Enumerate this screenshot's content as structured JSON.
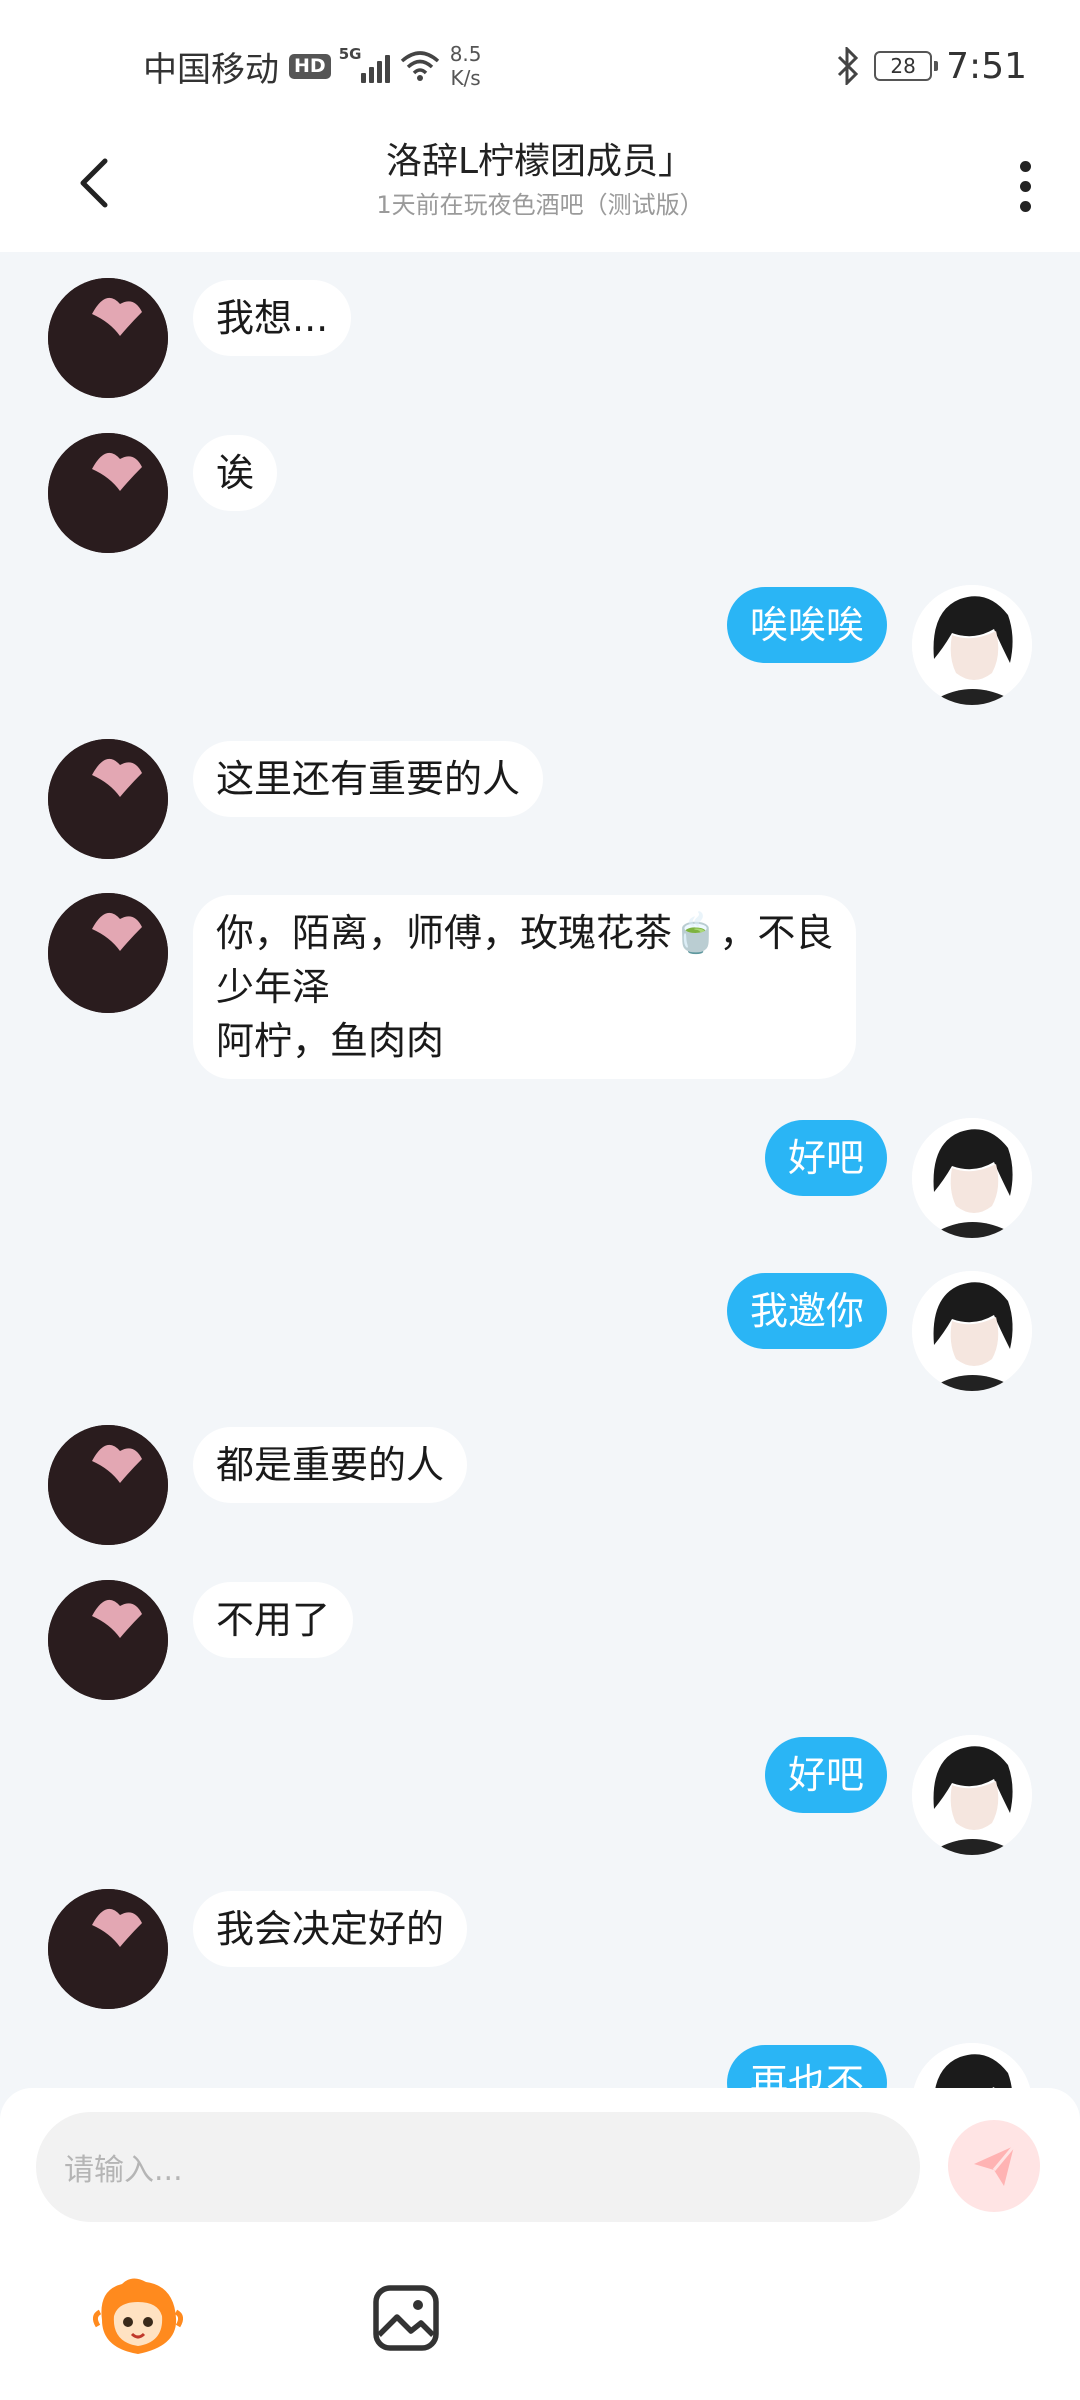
{
  "status_bar": {
    "carrier": "中国移动",
    "hd_badge": "HD",
    "network": "5G",
    "speed_value": "8.5",
    "speed_unit": "K/s",
    "battery": "28",
    "time": "7:51"
  },
  "header": {
    "title": "洛辞L柠檬团成员」",
    "subtitle": "1天前在玩夜色酒吧（测试版）"
  },
  "messages": [
    {
      "side": "left",
      "text": "我想..."
    },
    {
      "side": "left",
      "text": "诶"
    },
    {
      "side": "right",
      "text": "唉唉唉"
    },
    {
      "side": "left",
      "text": "这里还有重要的人"
    },
    {
      "side": "left",
      "text": "你，陌离，师傅，玫瑰花茶🍵，不良\n少年泽\n阿柠，鱼肉肉"
    },
    {
      "side": "right",
      "text": "好吧"
    },
    {
      "side": "right",
      "text": "我邀你"
    },
    {
      "side": "left",
      "text": "都是重要的人"
    },
    {
      "side": "left",
      "text": "不用了"
    },
    {
      "side": "right",
      "text": "好吧"
    },
    {
      "side": "left",
      "text": "我会决定好的"
    },
    {
      "side": "right",
      "text": "再也不"
    }
  ],
  "input": {
    "placeholder": "请输入..."
  },
  "colors": {
    "chat_background": "#f3f6f9",
    "outgoing_bubble": "#2ab5f5",
    "incoming_bubble": "#ffffff",
    "send_button": "#ffe4e4",
    "send_icon": "#ffb3b3"
  },
  "icons": [
    "back-arrow-icon",
    "more-vertical-icon",
    "send-icon",
    "character-emoji-icon",
    "image-icon",
    "bluetooth-icon",
    "wifi-icon",
    "signal-icon",
    "battery-icon"
  ]
}
